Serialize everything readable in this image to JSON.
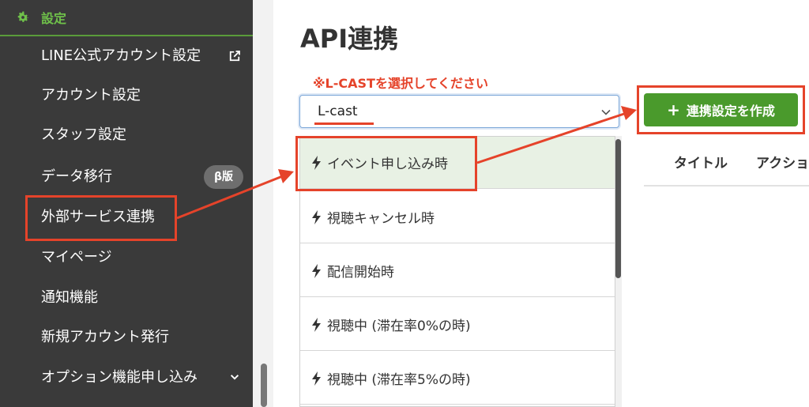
{
  "sidebar": {
    "header_label": "設定",
    "items": [
      {
        "label": "LINE公式アカウント設定"
      },
      {
        "label": "アカウント設定"
      },
      {
        "label": "スタッフ設定"
      },
      {
        "label": "データ移行"
      },
      {
        "label": "外部サービス連携"
      },
      {
        "label": "マイページ"
      },
      {
        "label": "通知機能"
      },
      {
        "label": "新規アカウント発行"
      },
      {
        "label": "オプション機能申し込み"
      }
    ],
    "beta_badge": "β版"
  },
  "main": {
    "title": "API連携",
    "annotation": "※L-CASTを選択してください",
    "select": {
      "value": "L-cast"
    },
    "dropdown": [
      {
        "label": "イベント申し込み時"
      },
      {
        "label": "視聴キャンセル時"
      },
      {
        "label": "配信開始時"
      },
      {
        "label": "視聴中 (滞在率0%の時)"
      },
      {
        "label": "視聴中 (滞在率5%の時)"
      }
    ],
    "create_button": "連携設定を作成",
    "table_columns": [
      "タイトル",
      "アクショ"
    ]
  },
  "colors": {
    "accent_green": "#4a9a2c",
    "annotation_red": "#e5432a",
    "sidebar_bg": "#3a3a3a"
  },
  "icons": {
    "settings": "gear-icon",
    "external_link": "external-link-icon",
    "dropdown_item": "lightning-bolt-icon",
    "expand": "chevron-down-icon",
    "create": "plus-icon"
  }
}
